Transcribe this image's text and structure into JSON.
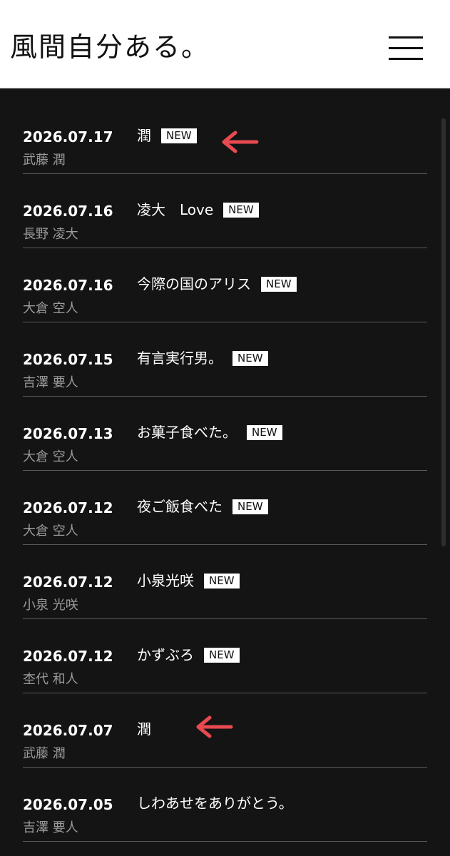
{
  "header": {
    "logo_text": "風間自分ある。",
    "menu_icon": "hamburger-menu-icon"
  },
  "colors": {
    "background": "#141414",
    "header_bg": "#ffffff",
    "arrow": "#e84a4f",
    "divider": "#5a5a5a",
    "author_text": "#9b9b9b"
  },
  "posts": [
    {
      "date": "2026.07.17",
      "title": "潤",
      "badge": "NEW",
      "author": "武藤 潤"
    },
    {
      "date": "2026.07.16",
      "title": "凌大　Love",
      "badge": "NEW",
      "author": "長野 凌大"
    },
    {
      "date": "2026.07.16",
      "title": "今際の国のアリス",
      "badge": "NEW",
      "author": "大倉 空人"
    },
    {
      "date": "2026.07.15",
      "title": "有言実行男。",
      "badge": "NEW",
      "author": "吉澤 要人"
    },
    {
      "date": "2026.07.13",
      "title": "お菓子食べた。",
      "badge": "NEW",
      "author": "大倉 空人"
    },
    {
      "date": "2026.07.12",
      "title": "夜ご飯食べた",
      "badge": "NEW",
      "author": "大倉 空人"
    },
    {
      "date": "2026.07.12",
      "title": "小泉光咲",
      "badge": "NEW",
      "author": "小泉 光咲"
    },
    {
      "date": "2026.07.12",
      "title": "かずぶろ",
      "badge": "NEW",
      "author": "杢代 和人"
    },
    {
      "date": "2026.07.07",
      "title": "潤",
      "badge": "",
      "author": "武藤 潤"
    },
    {
      "date": "2026.07.05",
      "title": "しわあせをありがとう。",
      "badge": "",
      "author": "吉澤 要人"
    }
  ],
  "annotations": {
    "arrow_icon": "left-arrow-icon"
  }
}
